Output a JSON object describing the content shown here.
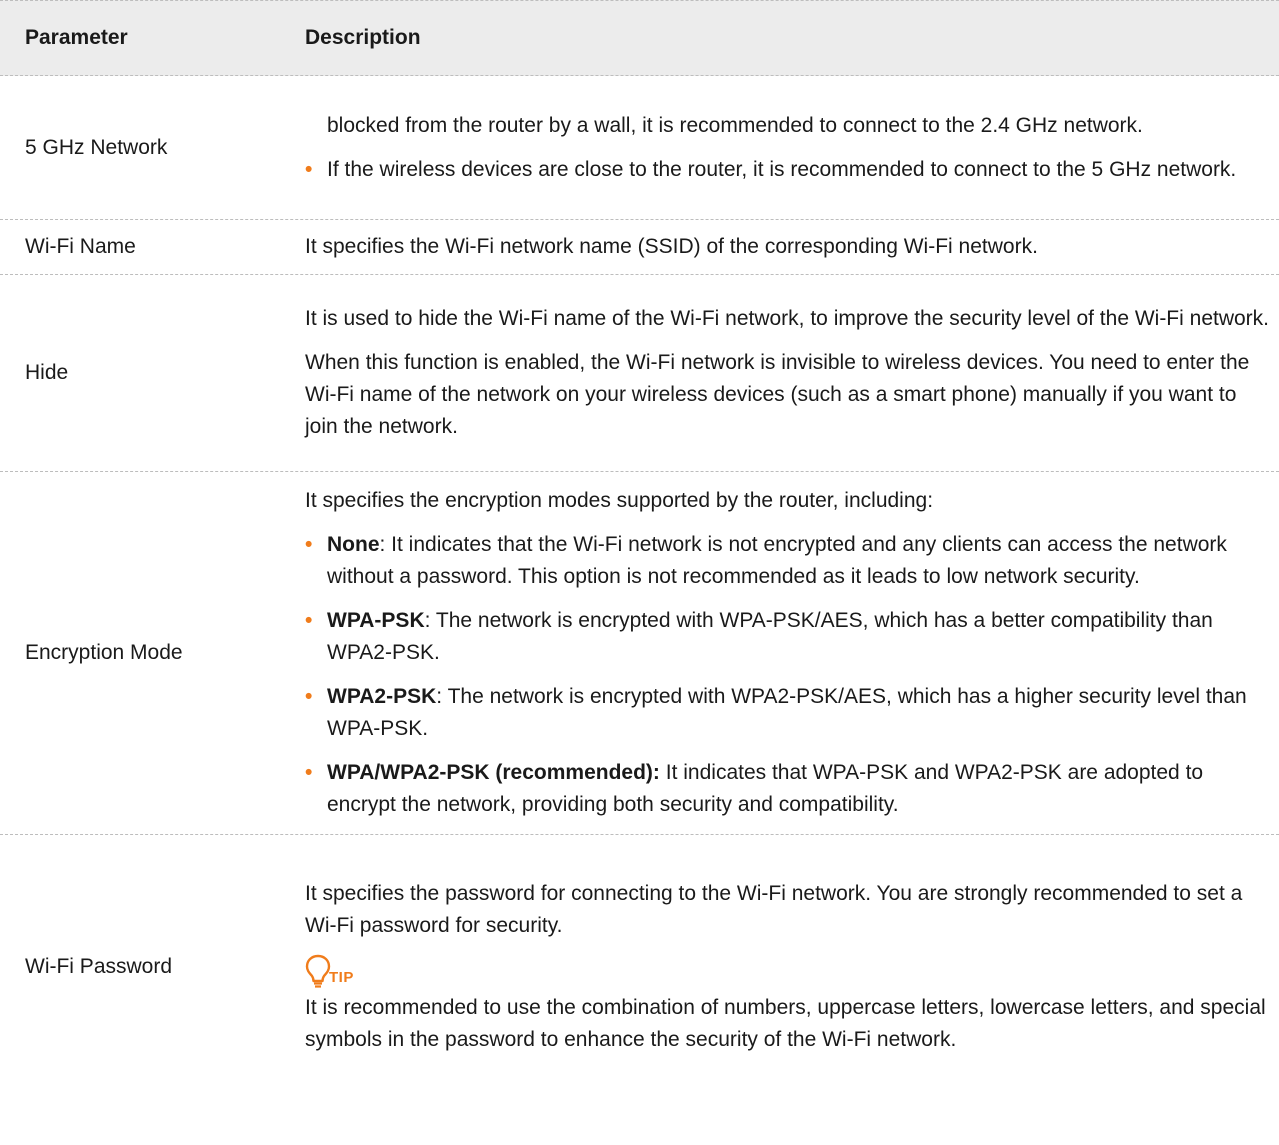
{
  "header": {
    "parameter": "Parameter",
    "description": "Description"
  },
  "rows": [
    {
      "name": "5 GHz Network",
      "lines": [
        "blocked from the router by a wall, it is recommended to connect to the 2.4 GHz network."
      ],
      "bullets": [
        "If the wireless devices are close to the router, it is recommended to connect to the 5 GHz network."
      ]
    },
    {
      "name": "Wi-Fi Name",
      "text": "It specifies the Wi-Fi network name (SSID) of the corresponding Wi-Fi network."
    },
    {
      "name": "Hide",
      "paras": [
        "It is used to hide the Wi-Fi name of the Wi-Fi network, to improve the security level of the Wi-Fi network.",
        "When this function is enabled, the Wi-Fi network is invisible to wireless devices. You need to enter the Wi-Fi name of the network on your wireless devices (such as a smart phone) manually if you want to join the network."
      ]
    },
    {
      "name": "Encryption Mode",
      "intro": "It specifies the encryption modes supported by the router, including:",
      "bullets": [
        {
          "term": "None",
          "text": ": It indicates that the Wi-Fi network is not encrypted and any clients can access the network without a password. This option is not recommended as it leads to low network security."
        },
        {
          "term": "WPA-PSK",
          "text": ": The network is encrypted with WPA-PSK/AES, which has a better compatibility than WPA2-PSK."
        },
        {
          "term": "WPA2-PSK",
          "text": ": The network is encrypted with WPA2-PSK/AES, which has a higher security level than WPA-PSK."
        },
        {
          "term": "WPA/WPA2-PSK (recommended):",
          "text": " It indicates that WPA-PSK and WPA2-PSK are adopted to encrypt the network, providing both security and compatibility."
        }
      ]
    },
    {
      "name": "Wi-Fi Password",
      "intro": "It specifies the password for connecting to the Wi-Fi network. You are strongly recommended to set a Wi-Fi password for security.",
      "tip_label": "TIP",
      "tip_text": "It is recommended to use the combination of numbers, uppercase letters, lowercase letters, and special symbols in the password to enhance the security of the Wi-Fi network."
    }
  ],
  "colors": {
    "accent": "#f07c1b",
    "header_bg": "#ececec",
    "divider": "#bdbdbd"
  },
  "icons": {
    "bullet": "bullet-dot-icon",
    "tip": "lightbulb-icon"
  }
}
